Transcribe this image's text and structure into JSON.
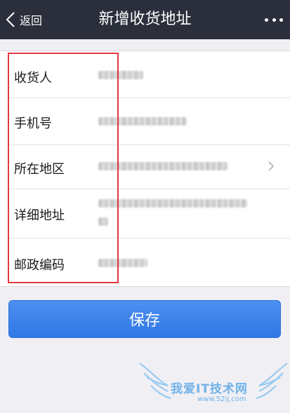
{
  "nav": {
    "back_label": "返回",
    "title": "新增收货地址"
  },
  "form": {
    "fields": [
      {
        "label": "收货人"
      },
      {
        "label": "手机号"
      },
      {
        "label": "所在地区"
      },
      {
        "label": "详细地址"
      },
      {
        "label": "邮政编码"
      }
    ]
  },
  "save_label": "保存",
  "watermark": {
    "text": "我爱IT技术网",
    "url": "www.52ij.com"
  },
  "colors": {
    "navbar": "#2b2f3b",
    "accent": "#3078e6",
    "highlight": "#e2393f",
    "background": "#efeff4"
  },
  "icons": [
    "chevron-left-icon",
    "more-icon",
    "chevron-right-icon"
  ]
}
